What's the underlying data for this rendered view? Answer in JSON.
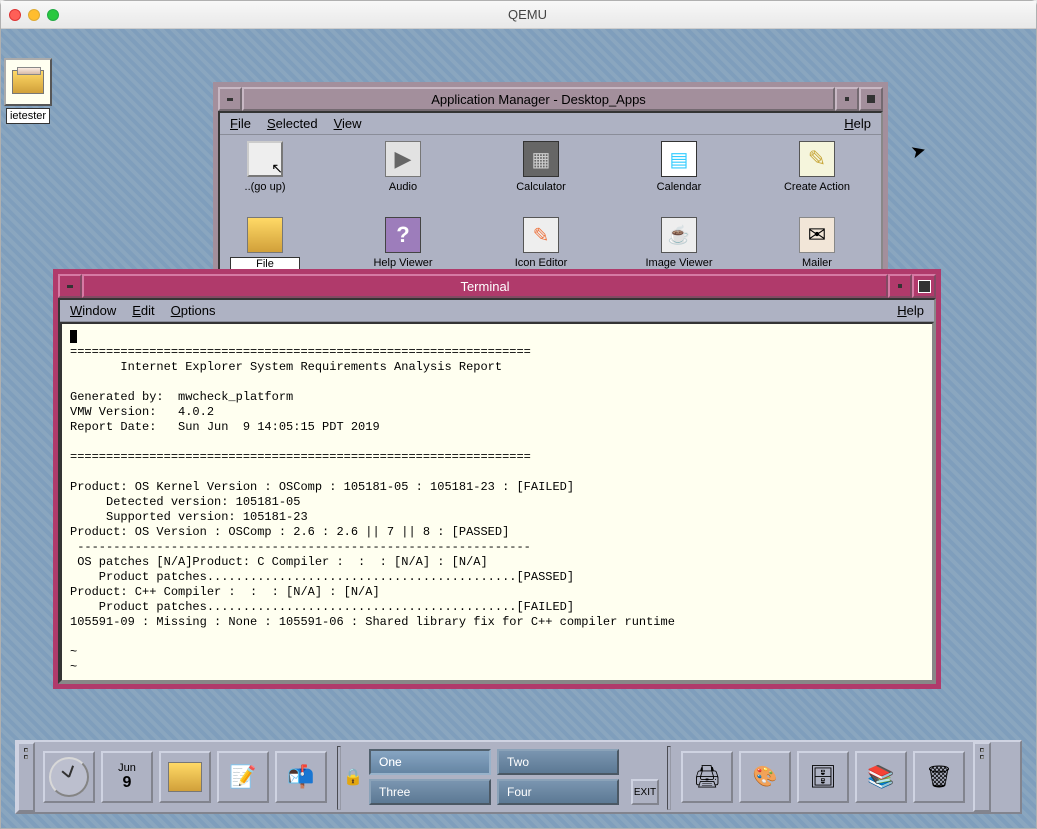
{
  "host": {
    "title": "QEMU"
  },
  "desktop": {
    "icon_label": "ietester"
  },
  "appmgr": {
    "title": "Application Manager - Desktop_Apps",
    "menu": {
      "file": "File",
      "selected": "Selected",
      "view": "View",
      "help": "Help"
    },
    "row1": [
      {
        "label": "..(go up)"
      },
      {
        "label": "Audio"
      },
      {
        "label": "Calculator"
      },
      {
        "label": "Calendar"
      },
      {
        "label": "Create Action"
      }
    ],
    "row2": [
      {
        "label": "File Manager",
        "selected": true
      },
      {
        "label": "Help Viewer"
      },
      {
        "label": "Icon Editor"
      },
      {
        "label": "Image Viewer"
      },
      {
        "label": "Mailer"
      }
    ]
  },
  "terminal": {
    "title": "Terminal",
    "menu": {
      "window": "Window",
      "edit": "Edit",
      "options": "Options",
      "help": "Help"
    },
    "content": "================================================================\n       Internet Explorer System Requirements Analysis Report\n\nGenerated by:  mwcheck_platform\nVMW Version:   4.0.2\nReport Date:   Sun Jun  9 14:05:15 PDT 2019\n\n================================================================\n\nProduct: OS Kernel Version : OSComp : 105181-05 : 105181-23 : [FAILED]\n     Detected version: 105181-05\n     Supported version: 105181-23\nProduct: OS Version : OSComp : 2.6 : 2.6 || 7 || 8 : [PASSED]\n ---------------------------------------------------------------\n OS patches [N/A]Product: C Compiler :  :  : [N/A] : [N/A]\n    Product patches...........................................[PASSED]\nProduct: C++ Compiler :  :  : [N/A] : [N/A]\n    Product patches...........................................[FAILED]\n105591-09 : Missing : None : 105591-06 : Shared library fix for C++ compiler runtime\n\n~\n~\n~\n~\n~"
  },
  "frontpanel": {
    "date": {
      "month": "Jun",
      "day": "9"
    },
    "lock": "🔒",
    "workspaces": [
      {
        "label": "One",
        "active": true
      },
      {
        "label": "Two",
        "active": false
      },
      {
        "label": "Three",
        "active": false
      },
      {
        "label": "Four",
        "active": false
      }
    ],
    "exit": "EXIT"
  }
}
